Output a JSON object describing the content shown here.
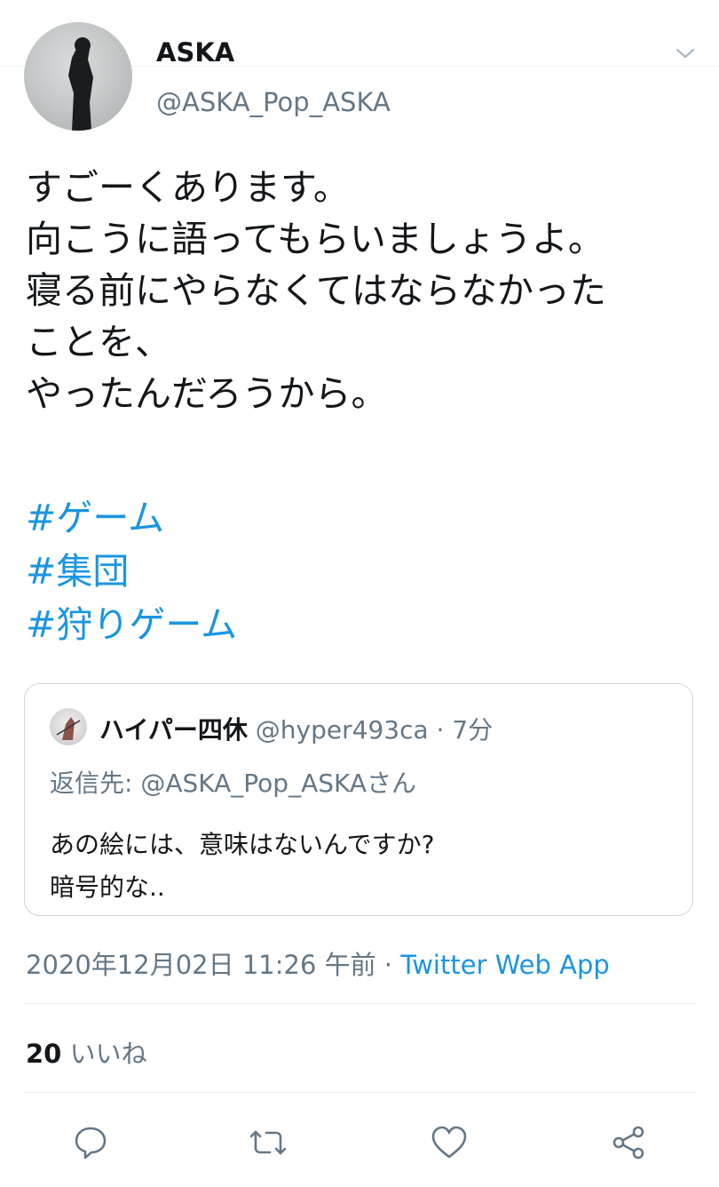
{
  "tweet": {
    "author_name": "ASKA",
    "author_handle": "@ASKA_Pop_ASKA",
    "lines": [
      "すごーくあります。",
      "向こうに語ってもらいましょうよ。",
      "寝る前にやらなくてはならなかった",
      "ことを、",
      "やったんだろうから。"
    ],
    "hashtags": [
      "#ゲーム",
      "#集団",
      "#狩りゲーム"
    ],
    "timestamp": "2020年12月02日 11:26 午前",
    "separator": " · ",
    "source_app": "Twitter Web App",
    "like_count": "20",
    "like_label": "いいね"
  },
  "quoted": {
    "name": "ハイパー四休",
    "handle": "@hyper493ca",
    "separator": " · ",
    "time": "7分",
    "reply_to": "返信先: @ASKA_Pop_ASKAさん",
    "body_lines": [
      "あの絵には、意味はないんですか?",
      "暗号的な.."
    ]
  },
  "icons": {
    "menu": "chevron-down-icon",
    "reply": "reply-icon",
    "retweet": "retweet-icon",
    "like": "heart-icon",
    "share": "share-icon"
  },
  "colors": {
    "link": "#1b95e0",
    "secondary_text": "#657786",
    "primary_text": "#14171a",
    "divider": "#e6ecf0"
  }
}
